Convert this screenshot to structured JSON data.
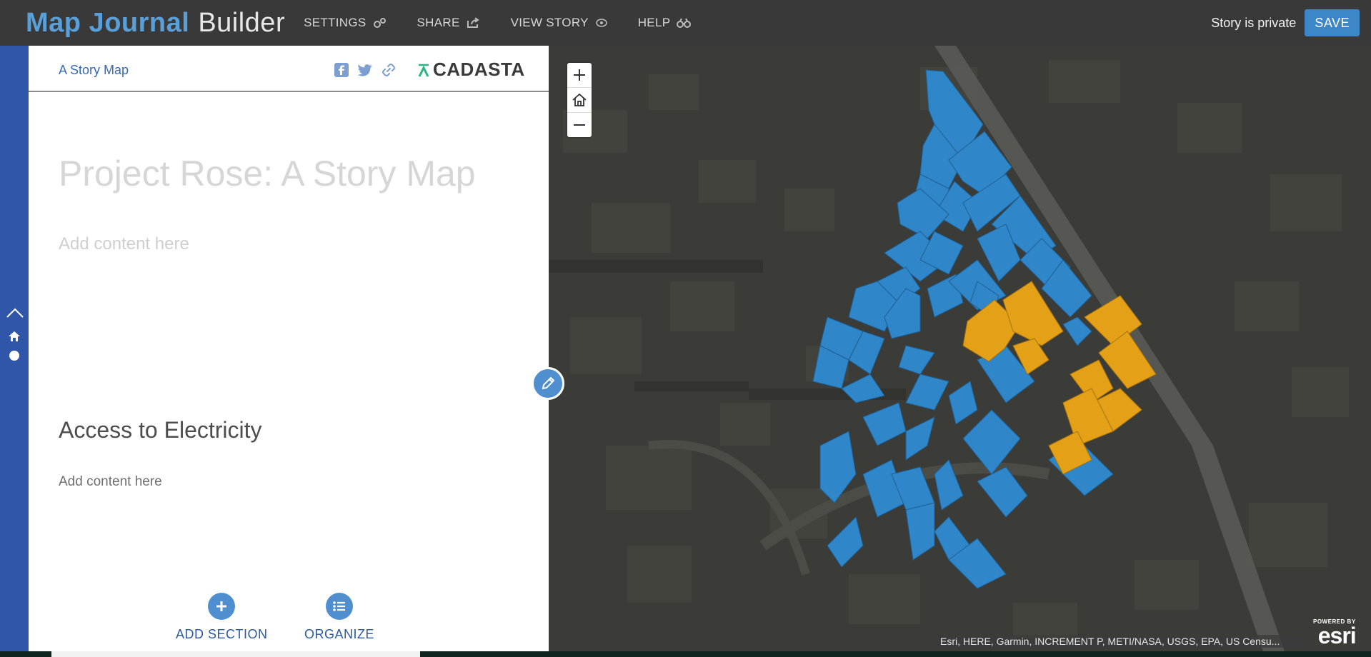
{
  "app": {
    "brand_part1": "Map Journal",
    "brand_part2": "Builder"
  },
  "topnav": [
    {
      "label": "SETTINGS",
      "icon": "gears-icon"
    },
    {
      "label": "SHARE",
      "icon": "share-icon"
    },
    {
      "label": "VIEW STORY",
      "icon": "eye-icon"
    },
    {
      "label": "HELP",
      "icon": "binoculars-icon"
    }
  ],
  "status": {
    "privacy": "Story is private",
    "save_label": "SAVE"
  },
  "panel": {
    "story_link": "A Story Map",
    "logo_text": "CADASTA",
    "title": "Project Rose: A Story Map",
    "content_placeholder": "Add content here",
    "section": {
      "title": "Access to Electricity",
      "content": "Add content here"
    },
    "actions": {
      "add_section": "ADD SECTION",
      "organize": "ORGANIZE"
    }
  },
  "map": {
    "attribution": "Esri, HERE, Garmin, INCREMENT P, METI/NASA, USGS, EPA, US Censu...",
    "esri_powered": "POWERED BY",
    "esri_name": "esri",
    "parcel_colors": {
      "blue": "#2f86c9",
      "orange": "#e4a017"
    }
  },
  "colors": {
    "accent": "#3d86c8",
    "leftnav": "#2f56a8",
    "link": "#3769b0"
  }
}
